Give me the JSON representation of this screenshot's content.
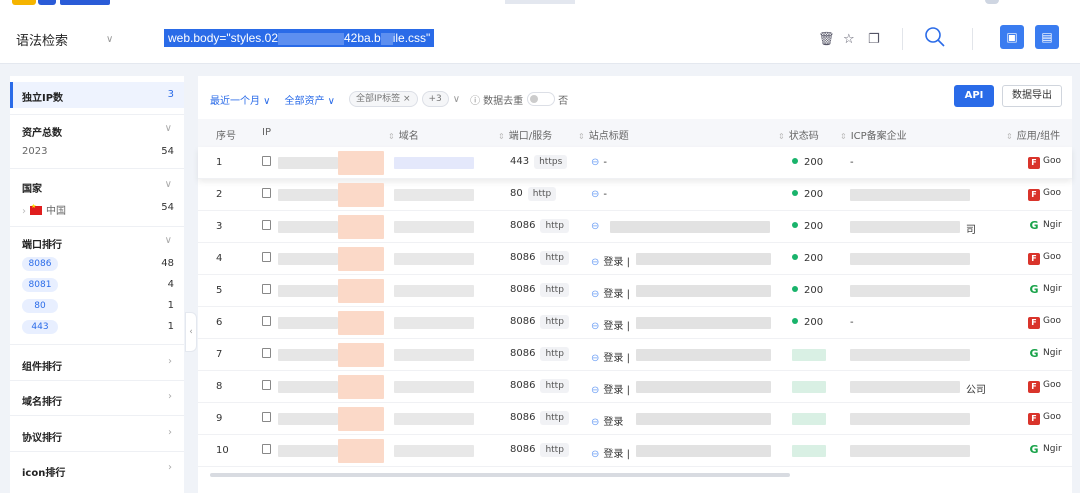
{
  "search": {
    "mode": "语法检索",
    "query_prefix": "web.body=\"styles.02",
    "query_mid": "42ba.b",
    "query_suffix": "ile.css\""
  },
  "sidebar": {
    "groups": [
      {
        "title": "独立IP数",
        "count": "3"
      },
      {
        "title": "资产总数",
        "sub": "2023",
        "sub_count": "54"
      },
      {
        "title": "国家",
        "sub": "中国",
        "sub_count": "54"
      },
      {
        "title": "端口排行",
        "ports": [
          {
            "port": "8086",
            "count": "48"
          },
          {
            "port": "8081",
            "count": "4"
          },
          {
            "port": "80",
            "count": "1"
          },
          {
            "port": "443",
            "count": "1"
          }
        ]
      },
      {
        "title": "组件排行"
      },
      {
        "title": "域名排行"
      },
      {
        "title": "协议排行"
      },
      {
        "title": "icon排行"
      }
    ]
  },
  "filters": {
    "time": "最近一个月",
    "assets": "全部资产",
    "tags": "全部IP标签",
    "tags_more": "+3",
    "dedup_label": "数据去重",
    "dedup_value": "否"
  },
  "buttons": {
    "api": "API",
    "export": "数据导出"
  },
  "table": {
    "headers": [
      "序号",
      "IP",
      "域名",
      "端口/服务",
      "站点标题",
      "状态码",
      "ICP备案企业",
      "应用/组件"
    ],
    "rows": [
      {
        "no": "1",
        "port": "443",
        "proto": "https",
        "title": "-",
        "status": "200",
        "icp": "-",
        "app": "Goo",
        "app_kind": "red"
      },
      {
        "no": "2",
        "port": "80",
        "proto": "http",
        "title": "-",
        "status": "200",
        "icp": "",
        "app": "Goo",
        "app_kind": "red"
      },
      {
        "no": "3",
        "port": "8086",
        "proto": "http",
        "title": "",
        "status": "200",
        "icp": "司",
        "app": "Ngir",
        "app_kind": "green"
      },
      {
        "no": "4",
        "port": "8086",
        "proto": "http",
        "title": "登录 |",
        "status": "200",
        "icp": "",
        "app": "Goo",
        "app_kind": "red"
      },
      {
        "no": "5",
        "port": "8086",
        "proto": "http",
        "title": "登录 |",
        "status": "200",
        "icp": "",
        "app": "Ngir",
        "app_kind": "green"
      },
      {
        "no": "6",
        "port": "8086",
        "proto": "http",
        "title": "登录 |",
        "status": "200",
        "icp": "-",
        "app": "Goo",
        "app_kind": "red"
      },
      {
        "no": "7",
        "port": "8086",
        "proto": "http",
        "title": "登录 |",
        "status": "",
        "icp": "",
        "app": "Ngir",
        "app_kind": "green"
      },
      {
        "no": "8",
        "port": "8086",
        "proto": "http",
        "title": "登录 |",
        "status": "",
        "icp": "公司",
        "app": "Goo",
        "app_kind": "red"
      },
      {
        "no": "9",
        "port": "8086",
        "proto": "http",
        "title": "登录",
        "status": "",
        "icp": "",
        "app": "Goo",
        "app_kind": "red"
      },
      {
        "no": "10",
        "port": "8086",
        "proto": "http",
        "title": "登录 |",
        "status": "",
        "icp": "",
        "app": "Ngir",
        "app_kind": "green"
      }
    ]
  },
  "colors": {
    "accent": "#2a6be8",
    "status_ok": "#19b36b",
    "app_red": "#d9342b",
    "app_green": "#1aa34a"
  }
}
